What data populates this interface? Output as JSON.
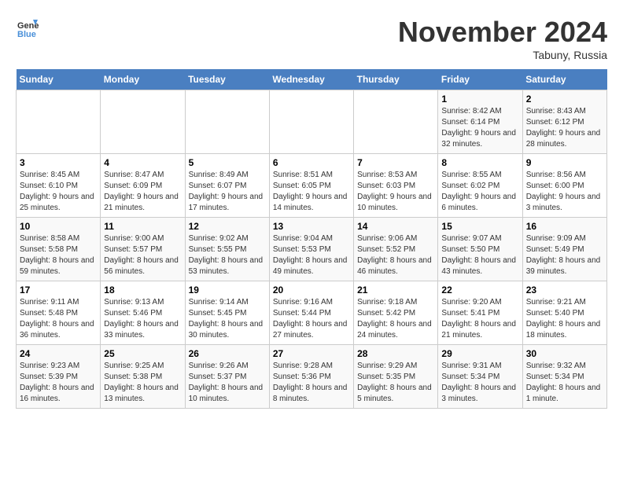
{
  "header": {
    "logo_line1": "General",
    "logo_line2": "Blue",
    "month": "November 2024",
    "location": "Tabuny, Russia"
  },
  "weekdays": [
    "Sunday",
    "Monday",
    "Tuesday",
    "Wednesday",
    "Thursday",
    "Friday",
    "Saturday"
  ],
  "weeks": [
    [
      {
        "day": "",
        "info": ""
      },
      {
        "day": "",
        "info": ""
      },
      {
        "day": "",
        "info": ""
      },
      {
        "day": "",
        "info": ""
      },
      {
        "day": "",
        "info": ""
      },
      {
        "day": "1",
        "info": "Sunrise: 8:42 AM\nSunset: 6:14 PM\nDaylight: 9 hours and 32 minutes."
      },
      {
        "day": "2",
        "info": "Sunrise: 8:43 AM\nSunset: 6:12 PM\nDaylight: 9 hours and 28 minutes."
      }
    ],
    [
      {
        "day": "3",
        "info": "Sunrise: 8:45 AM\nSunset: 6:10 PM\nDaylight: 9 hours and 25 minutes."
      },
      {
        "day": "4",
        "info": "Sunrise: 8:47 AM\nSunset: 6:09 PM\nDaylight: 9 hours and 21 minutes."
      },
      {
        "day": "5",
        "info": "Sunrise: 8:49 AM\nSunset: 6:07 PM\nDaylight: 9 hours and 17 minutes."
      },
      {
        "day": "6",
        "info": "Sunrise: 8:51 AM\nSunset: 6:05 PM\nDaylight: 9 hours and 14 minutes."
      },
      {
        "day": "7",
        "info": "Sunrise: 8:53 AM\nSunset: 6:03 PM\nDaylight: 9 hours and 10 minutes."
      },
      {
        "day": "8",
        "info": "Sunrise: 8:55 AM\nSunset: 6:02 PM\nDaylight: 9 hours and 6 minutes."
      },
      {
        "day": "9",
        "info": "Sunrise: 8:56 AM\nSunset: 6:00 PM\nDaylight: 9 hours and 3 minutes."
      }
    ],
    [
      {
        "day": "10",
        "info": "Sunrise: 8:58 AM\nSunset: 5:58 PM\nDaylight: 8 hours and 59 minutes."
      },
      {
        "day": "11",
        "info": "Sunrise: 9:00 AM\nSunset: 5:57 PM\nDaylight: 8 hours and 56 minutes."
      },
      {
        "day": "12",
        "info": "Sunrise: 9:02 AM\nSunset: 5:55 PM\nDaylight: 8 hours and 53 minutes."
      },
      {
        "day": "13",
        "info": "Sunrise: 9:04 AM\nSunset: 5:53 PM\nDaylight: 8 hours and 49 minutes."
      },
      {
        "day": "14",
        "info": "Sunrise: 9:06 AM\nSunset: 5:52 PM\nDaylight: 8 hours and 46 minutes."
      },
      {
        "day": "15",
        "info": "Sunrise: 9:07 AM\nSunset: 5:50 PM\nDaylight: 8 hours and 43 minutes."
      },
      {
        "day": "16",
        "info": "Sunrise: 9:09 AM\nSunset: 5:49 PM\nDaylight: 8 hours and 39 minutes."
      }
    ],
    [
      {
        "day": "17",
        "info": "Sunrise: 9:11 AM\nSunset: 5:48 PM\nDaylight: 8 hours and 36 minutes."
      },
      {
        "day": "18",
        "info": "Sunrise: 9:13 AM\nSunset: 5:46 PM\nDaylight: 8 hours and 33 minutes."
      },
      {
        "day": "19",
        "info": "Sunrise: 9:14 AM\nSunset: 5:45 PM\nDaylight: 8 hours and 30 minutes."
      },
      {
        "day": "20",
        "info": "Sunrise: 9:16 AM\nSunset: 5:44 PM\nDaylight: 8 hours and 27 minutes."
      },
      {
        "day": "21",
        "info": "Sunrise: 9:18 AM\nSunset: 5:42 PM\nDaylight: 8 hours and 24 minutes."
      },
      {
        "day": "22",
        "info": "Sunrise: 9:20 AM\nSunset: 5:41 PM\nDaylight: 8 hours and 21 minutes."
      },
      {
        "day": "23",
        "info": "Sunrise: 9:21 AM\nSunset: 5:40 PM\nDaylight: 8 hours and 18 minutes."
      }
    ],
    [
      {
        "day": "24",
        "info": "Sunrise: 9:23 AM\nSunset: 5:39 PM\nDaylight: 8 hours and 16 minutes."
      },
      {
        "day": "25",
        "info": "Sunrise: 9:25 AM\nSunset: 5:38 PM\nDaylight: 8 hours and 13 minutes."
      },
      {
        "day": "26",
        "info": "Sunrise: 9:26 AM\nSunset: 5:37 PM\nDaylight: 8 hours and 10 minutes."
      },
      {
        "day": "27",
        "info": "Sunrise: 9:28 AM\nSunset: 5:36 PM\nDaylight: 8 hours and 8 minutes."
      },
      {
        "day": "28",
        "info": "Sunrise: 9:29 AM\nSunset: 5:35 PM\nDaylight: 8 hours and 5 minutes."
      },
      {
        "day": "29",
        "info": "Sunrise: 9:31 AM\nSunset: 5:34 PM\nDaylight: 8 hours and 3 minutes."
      },
      {
        "day": "30",
        "info": "Sunrise: 9:32 AM\nSunset: 5:34 PM\nDaylight: 8 hours and 1 minute."
      }
    ]
  ]
}
